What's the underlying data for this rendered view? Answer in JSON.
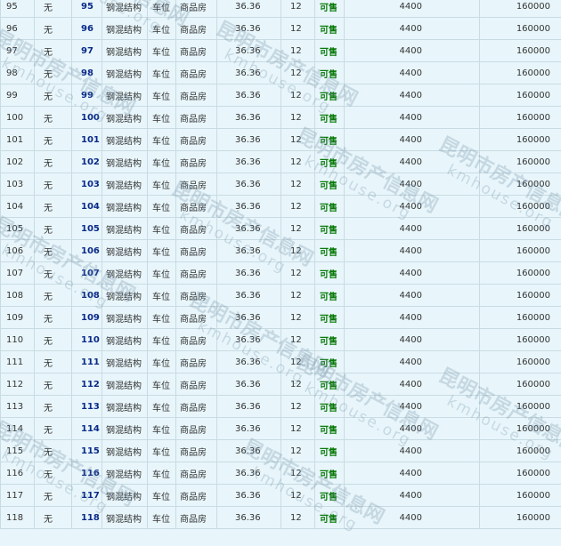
{
  "rows": [
    {
      "id": "95",
      "property": "无",
      "room": "95",
      "structure": "钢混结构",
      "use": "车位",
      "type": "商品房",
      "area": "36.36",
      "floor": "12",
      "status": "可售",
      "unit_price": "4400",
      "total": "160000"
    },
    {
      "id": "96",
      "property": "无",
      "room": "96",
      "structure": "钢混结构",
      "use": "车位",
      "type": "商品房",
      "area": "36.36",
      "floor": "12",
      "status": "可售",
      "unit_price": "4400",
      "total": "160000"
    },
    {
      "id": "97",
      "property": "无",
      "room": "97",
      "structure": "钢混结构",
      "use": "车位",
      "type": "商品房",
      "area": "36.36",
      "floor": "12",
      "status": "可售",
      "unit_price": "4400",
      "total": "160000"
    },
    {
      "id": "98",
      "property": "无",
      "room": "98",
      "structure": "钢混结构",
      "use": "车位",
      "type": "商品房",
      "area": "36.36",
      "floor": "12",
      "status": "可售",
      "unit_price": "4400",
      "total": "160000"
    },
    {
      "id": "99",
      "property": "无",
      "room": "99",
      "structure": "钢混结构",
      "use": "车位",
      "type": "商品房",
      "area": "36.36",
      "floor": "12",
      "status": "可售",
      "unit_price": "4400",
      "total": "160000"
    },
    {
      "id": "100",
      "property": "无",
      "room": "100",
      "structure": "钢混结构",
      "use": "车位",
      "type": "商品房",
      "area": "36.36",
      "floor": "12",
      "status": "可售",
      "unit_price": "4400",
      "total": "160000"
    },
    {
      "id": "101",
      "property": "无",
      "room": "101",
      "structure": "钢混结构",
      "use": "车位",
      "type": "商品房",
      "area": "36.36",
      "floor": "12",
      "status": "可售",
      "unit_price": "4400",
      "total": "160000"
    },
    {
      "id": "102",
      "property": "无",
      "room": "102",
      "structure": "钢混结构",
      "use": "车位",
      "type": "商品房",
      "area": "36.36",
      "floor": "12",
      "status": "可售",
      "unit_price": "4400",
      "total": "160000"
    },
    {
      "id": "103",
      "property": "无",
      "room": "103",
      "structure": "钢混结构",
      "use": "车位",
      "type": "商品房",
      "area": "36.36",
      "floor": "12",
      "status": "可售",
      "unit_price": "4400",
      "total": "160000"
    },
    {
      "id": "104",
      "property": "无",
      "room": "104",
      "structure": "钢混结构",
      "use": "车位",
      "type": "商品房",
      "area": "36.36",
      "floor": "12",
      "status": "可售",
      "unit_price": "4400",
      "total": "160000"
    },
    {
      "id": "105",
      "property": "无",
      "room": "105",
      "structure": "钢混结构",
      "use": "车位",
      "type": "商品房",
      "area": "36.36",
      "floor": "12",
      "status": "可售",
      "unit_price": "4400",
      "total": "160000"
    },
    {
      "id": "106",
      "property": "无",
      "room": "106",
      "structure": "钢混结构",
      "use": "车位",
      "type": "商品房",
      "area": "36.36",
      "floor": "12",
      "status": "可售",
      "unit_price": "4400",
      "total": "160000"
    },
    {
      "id": "107",
      "property": "无",
      "room": "107",
      "structure": "钢混结构",
      "use": "车位",
      "type": "商品房",
      "area": "36.36",
      "floor": "12",
      "status": "可售",
      "unit_price": "4400",
      "total": "160000"
    },
    {
      "id": "108",
      "property": "无",
      "room": "108",
      "structure": "钢混结构",
      "use": "车位",
      "type": "商品房",
      "area": "36.36",
      "floor": "12",
      "status": "可售",
      "unit_price": "4400",
      "total": "160000"
    },
    {
      "id": "109",
      "property": "无",
      "room": "109",
      "structure": "钢混结构",
      "use": "车位",
      "type": "商品房",
      "area": "36.36",
      "floor": "12",
      "status": "可售",
      "unit_price": "4400",
      "total": "160000"
    },
    {
      "id": "110",
      "property": "无",
      "room": "110",
      "structure": "钢混结构",
      "use": "车位",
      "type": "商品房",
      "area": "36.36",
      "floor": "12",
      "status": "可售",
      "unit_price": "4400",
      "total": "160000"
    },
    {
      "id": "111",
      "property": "无",
      "room": "111",
      "structure": "钢混结构",
      "use": "车位",
      "type": "商品房",
      "area": "36.36",
      "floor": "12",
      "status": "可售",
      "unit_price": "4400",
      "total": "160000"
    },
    {
      "id": "112",
      "property": "无",
      "room": "112",
      "structure": "钢混结构",
      "use": "车位",
      "type": "商品房",
      "area": "36.36",
      "floor": "12",
      "status": "可售",
      "unit_price": "4400",
      "total": "160000"
    },
    {
      "id": "113",
      "property": "无",
      "room": "113",
      "structure": "钢混结构",
      "use": "车位",
      "type": "商品房",
      "area": "36.36",
      "floor": "12",
      "status": "可售",
      "unit_price": "4400",
      "total": "160000"
    },
    {
      "id": "114",
      "property": "无",
      "room": "114",
      "structure": "钢混结构",
      "use": "车位",
      "type": "商品房",
      "area": "36.36",
      "floor": "12",
      "status": "可售",
      "unit_price": "4400",
      "total": "160000"
    },
    {
      "id": "115",
      "property": "无",
      "room": "115",
      "structure": "钢混结构",
      "use": "车位",
      "type": "商品房",
      "area": "36.36",
      "floor": "12",
      "status": "可售",
      "unit_price": "4400",
      "total": "160000"
    },
    {
      "id": "116",
      "property": "无",
      "room": "116",
      "structure": "钢混结构",
      "use": "车位",
      "type": "商品房",
      "area": "36.36",
      "floor": "12",
      "status": "可售",
      "unit_price": "4400",
      "total": "160000"
    },
    {
      "id": "117",
      "property": "无",
      "room": "117",
      "structure": "钢混结构",
      "use": "车位",
      "type": "商品房",
      "area": "36.36",
      "floor": "12",
      "status": "可售",
      "unit_price": "4400",
      "total": "160000"
    },
    {
      "id": "118",
      "property": "无",
      "room": "118",
      "structure": "钢混结构",
      "use": "车位",
      "type": "商品房",
      "area": "36.36",
      "floor": "12",
      "status": "可售",
      "unit_price": "4400",
      "total": "160000"
    }
  ],
  "watermark": {
    "text": "昆明市房产信息网",
    "url": "kmhouse.org"
  },
  "colors": {
    "background": "#e8f6fb",
    "room_link": "#0a2a8a",
    "status_available": "#0a7a0a",
    "grid": "#c8dbe2"
  }
}
